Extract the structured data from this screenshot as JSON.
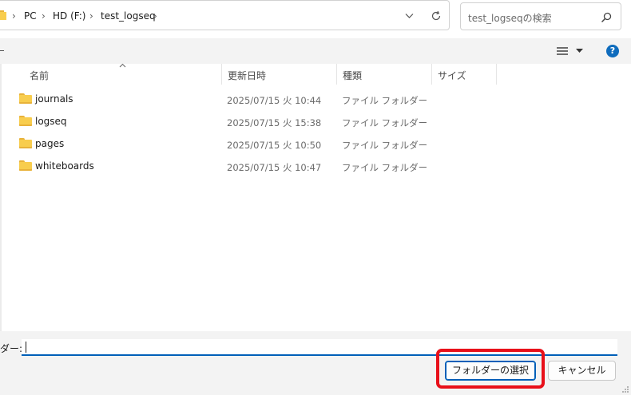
{
  "address_bar": {
    "crumbs": [
      "PC",
      "HD (F:)",
      "test_logseq"
    ]
  },
  "search": {
    "placeholder": "test_logseqの検索"
  },
  "toolbar": {
    "help_label": "?"
  },
  "columns": {
    "name": "名前",
    "date": "更新日時",
    "type": "種類",
    "size": "サイズ"
  },
  "files": [
    {
      "name": "journals",
      "date": "2025/07/15 火 10:44",
      "type": "ファイル フォルダー"
    },
    {
      "name": "logseq",
      "date": "2025/07/15 火 15:38",
      "type": "ファイル フォルダー"
    },
    {
      "name": "pages",
      "date": "2025/07/15 火 10:50",
      "type": "ファイル フォルダー"
    },
    {
      "name": "whiteboards",
      "date": "2025/07/15 火 10:47",
      "type": "ファイル フォルダー"
    }
  ],
  "bottom": {
    "folder_label": "ダー:",
    "folder_value": "",
    "select_button": "フォルダーの選択",
    "cancel_button": "キャンセル"
  },
  "colors": {
    "accent": "#005fb8",
    "highlight": "#e8101a",
    "folder": "#f8cd4e",
    "help": "#0f6cbd"
  }
}
